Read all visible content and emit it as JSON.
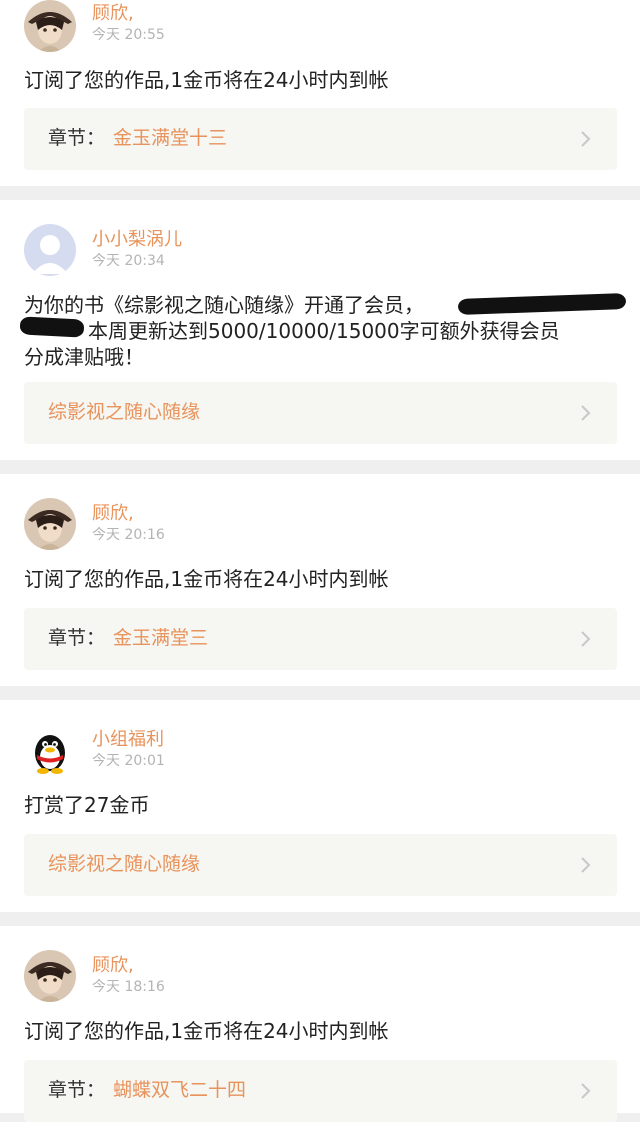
{
  "notifications": [
    {
      "user": "顾欣,",
      "time": "今天 20:55",
      "message": "订阅了您的作品,1金币将在24小时内到帐",
      "link": {
        "prefix": "章节：",
        "title": "金玉满堂十三"
      },
      "avatar": "anime-avatar"
    },
    {
      "user": "小小梨涡儿",
      "time": "今天 20:34",
      "message_line1": "为你的书《综影视之随心随缘》开通了会员，",
      "message_line2": "本周更新达到5000/10000/15000字可额外获得会员",
      "message_line3": "分成津贴哦！",
      "link": {
        "prefix": "",
        "title": "综影视之随心随缘"
      },
      "avatar": "default-avatar"
    },
    {
      "user": "顾欣,",
      "time": "今天 20:16",
      "message": "订阅了您的作品,1金币将在24小时内到帐",
      "link": {
        "prefix": "章节：",
        "title": "金玉满堂三"
      },
      "avatar": "anime-avatar"
    },
    {
      "user": "小组福利",
      "time": "今天 20:01",
      "message": "打赏了27金币",
      "link": {
        "prefix": "",
        "title": "综影视之随心随缘"
      },
      "avatar": "penguin-avatar"
    },
    {
      "user": "顾欣,",
      "time": "今天 18:16",
      "message": "订阅了您的作品,1金币将在24小时内到帐",
      "link": {
        "prefix": "章节：",
        "title": "蝴蝶双飞二十四"
      },
      "avatar": "anime-avatar"
    }
  ],
  "colors": {
    "accent": "#e8935b",
    "background": "#efefef",
    "link_bg": "#f6f6f2"
  },
  "icons": {
    "chevron": "chevron-right-icon"
  }
}
